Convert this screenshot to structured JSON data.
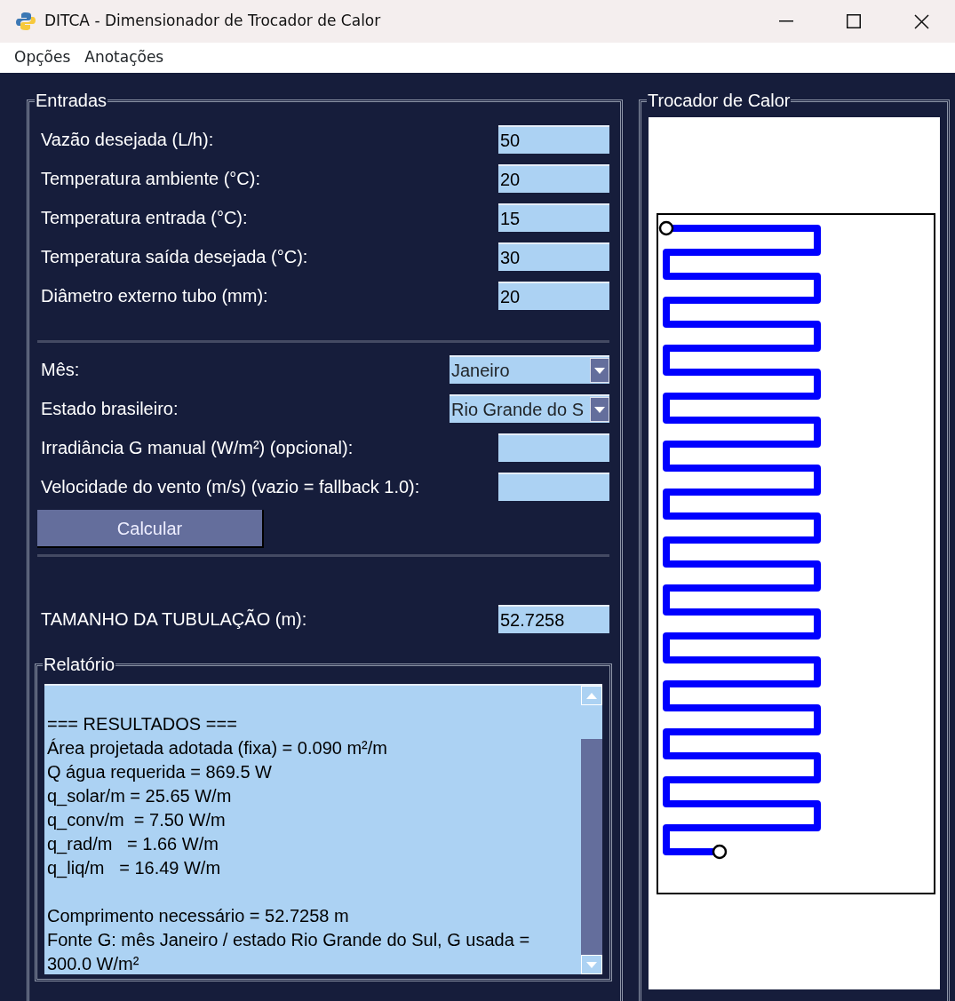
{
  "window": {
    "title": "DITCA - Dimensionador de Trocador de Calor"
  },
  "menu": [
    "Opções",
    "Anotações"
  ],
  "inputs": {
    "title": "Entradas",
    "fields": [
      {
        "label": "Vazão desejada (L/h):",
        "value": "50"
      },
      {
        "label": "Temperatura ambiente (°C):",
        "value": "20"
      },
      {
        "label": "Temperatura entrada (°C):",
        "value": "15"
      },
      {
        "label": "Temperatura saída desejada (°C):",
        "value": "30"
      },
      {
        "label": "Diâmetro externo tubo (mm):",
        "value": "20"
      }
    ],
    "selects": [
      {
        "label": "Mês:",
        "value": "Janeiro"
      },
      {
        "label": "Estado brasileiro:",
        "value": "Rio Grande do S"
      }
    ],
    "optional": [
      {
        "label": "Irradiância G manual (W/m²) (opcional):"
      },
      {
        "label": "Velocidade do vento (m/s) (vazio = fallback 1.0):"
      }
    ],
    "button": "Calcular",
    "result": {
      "label": "TAMANHO DA TUBULAÇÃO (m):",
      "value": "52.7258"
    }
  },
  "report": {
    "title": "Relatório",
    "blocks": [
      [
        "=== RESULTADOS ===",
        "Área projetada adotada (fixa) = 0.090 m²/m",
        "Q água requerida = 869.5 W",
        "q_solar/m = 25.65 W/m",
        "q_conv/m  = 7.50 W/m",
        "q_rad/m   = 1.66 W/m",
        "q_liq/m   = 16.49 W/m"
      ],
      [
        "Comprimento necessário = 52.7258 m",
        "Fonte G: mês Janeiro / estado Rio Grande do Sul, G usada = 300.0 W/m²"
      ]
    ]
  },
  "exchanger": {
    "title": "Trocador de Calor"
  }
}
